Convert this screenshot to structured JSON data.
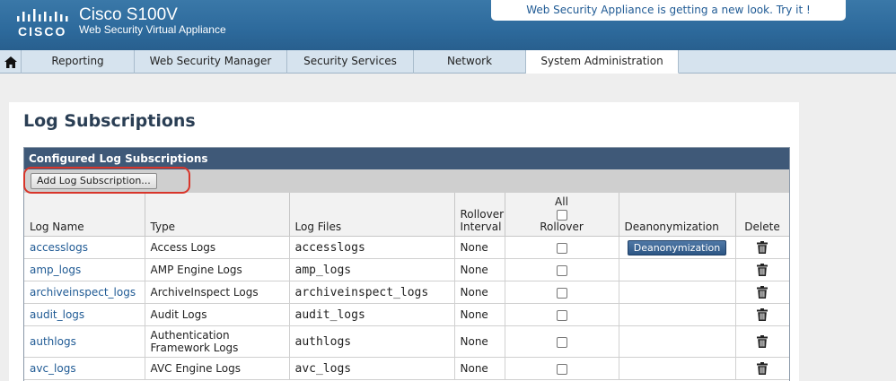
{
  "header": {
    "logo_word": "CISCO",
    "product_name": "Cisco S100V",
    "product_sub": "Web Security Virtual Appliance",
    "promo": "Web Security Appliance is getting a new look. Try it !"
  },
  "nav": {
    "tabs": [
      {
        "label": "Reporting"
      },
      {
        "label": "Web Security Manager"
      },
      {
        "label": "Security Services"
      },
      {
        "label": "Network"
      },
      {
        "label": "System Administration",
        "active": true
      }
    ]
  },
  "page": {
    "title": "Log Subscriptions",
    "section_title": "Configured Log Subscriptions",
    "add_button": "Add Log Subscription..."
  },
  "table": {
    "columns": {
      "log_name": "Log Name",
      "type": "Type",
      "log_files": "Log Files",
      "rollover_interval_1": "Rollover",
      "rollover_interval_2": "Interval",
      "all": "All",
      "rollover": "Rollover",
      "deanonymization": "Deanonymization",
      "delete": "Delete"
    },
    "rows": [
      {
        "name": "accesslogs",
        "type": "Access Logs",
        "files": "accesslogs",
        "interval": "None",
        "deanon": "Deanonymization"
      },
      {
        "name": "amp_logs",
        "type": "AMP Engine Logs",
        "files": "amp_logs",
        "interval": "None",
        "deanon": ""
      },
      {
        "name": "archiveinspect_logs",
        "type": "ArchiveInspect Logs",
        "files": "archiveinspect_logs",
        "interval": "None",
        "deanon": ""
      },
      {
        "name": "audit_logs",
        "type": "Audit Logs",
        "files": "audit_logs",
        "interval": "None",
        "deanon": ""
      },
      {
        "name": "authlogs",
        "type": "Authentication Framework Logs",
        "files": "authlogs",
        "interval": "None",
        "deanon": ""
      },
      {
        "name": "avc_logs",
        "type": "AVC Engine Logs",
        "files": "avc_logs",
        "interval": "None",
        "deanon": ""
      }
    ]
  },
  "colors": {
    "header_bg": "#2d6a9c",
    "section_header": "#3f5978",
    "link": "#1f5a94",
    "highlight": "#d8352a"
  }
}
